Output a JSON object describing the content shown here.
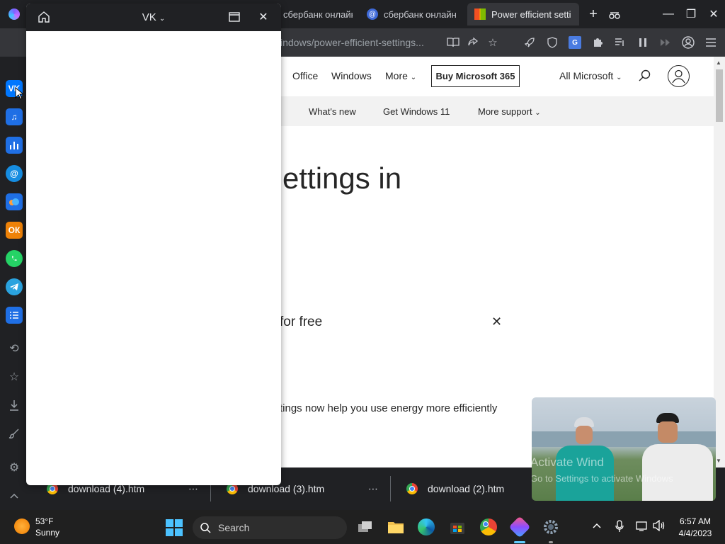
{
  "browser": {
    "tabs": [
      {
        "title": "сбербанк онлайн - Я",
        "favicon": "yandex-tab-icon",
        "active": false
      },
      {
        "title": "сбербанк онлайн - Я",
        "favicon": "at-mail-icon",
        "active": false
      },
      {
        "title": "Power efficient setti",
        "favicon": "microsoft-icon",
        "active": true
      }
    ],
    "url": "indows/power-efficient-settings...",
    "new_tab": "+",
    "window_controls": {
      "minimize": "—",
      "restore": "❐",
      "close": "✕"
    }
  },
  "sidebar": {
    "apps": [
      "vk-icon",
      "music-icon",
      "stats-icon",
      "mail-icon",
      "cloud-icon",
      "odnoklassniki-icon",
      "whatsapp-icon",
      "telegram-icon",
      "tasks-icon"
    ],
    "tools": [
      "history-icon",
      "favorites-icon",
      "downloads-icon",
      "brush-icon",
      "settings-icon",
      "collapse-icon"
    ]
  },
  "msnav": {
    "office": "Office",
    "windows": "Windows",
    "more": "More",
    "buy": "Buy Microsoft 365",
    "all_microsoft": "All Microsoft"
  },
  "subnav": {
    "whats_new": "What's new",
    "get_windows": "Get Windows 11",
    "more_support": "More support"
  },
  "article": {
    "title_fragment": "ettings in",
    "promo_fragment": "for free",
    "lead_fragment": "tings now help you use energy more efficiently"
  },
  "vk_panel": {
    "title": "VK"
  },
  "downloads": [
    {
      "name": "download (4).htm"
    },
    {
      "name": "download (3).htm"
    },
    {
      "name": "download (2).htm"
    }
  ],
  "video": {
    "watermark_line1": "Activate Wind",
    "watermark_line2": "Go to Settings to activate Windows"
  },
  "taskbar": {
    "weather_temp": "53°F",
    "weather_cond": "Sunny",
    "search_label": "Search",
    "time": "6:57 AM",
    "date": "4/4/2023"
  }
}
